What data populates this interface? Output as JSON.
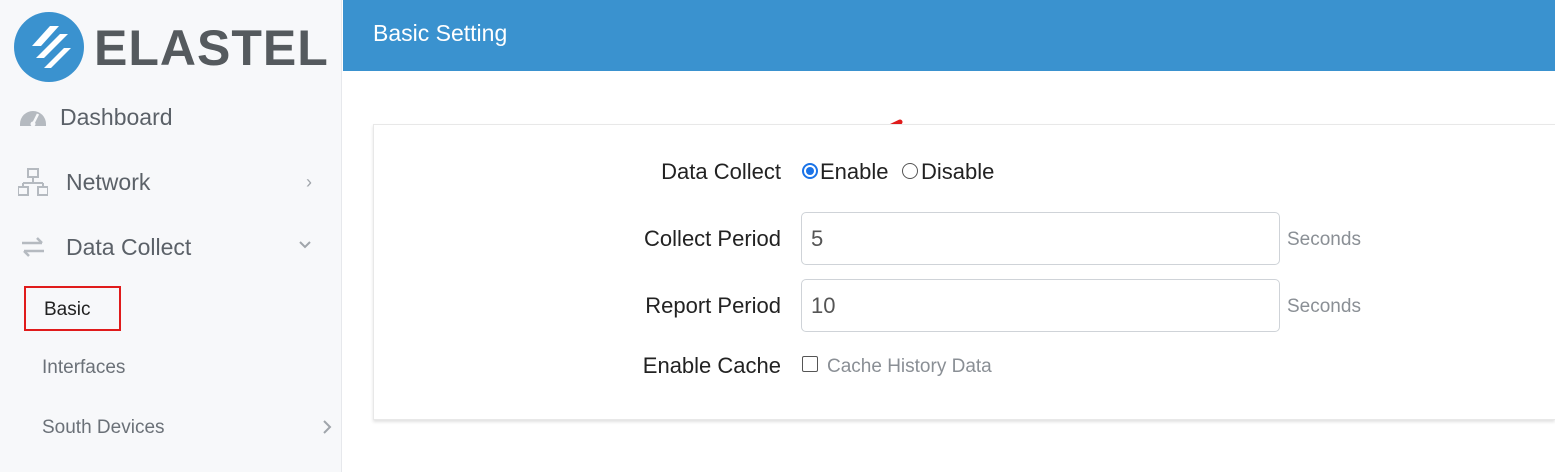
{
  "brand": {
    "name": "ELASTEL",
    "logo_color": "#3a92cf"
  },
  "sidebar": {
    "items": [
      {
        "label": "Dashboard",
        "icon": "dashboard-gauge-icon"
      },
      {
        "label": "Network",
        "icon": "network-icon",
        "chevron": "›"
      },
      {
        "label": "Data Collect",
        "icon": "transfer-arrows-icon",
        "chevron": "⌄"
      }
    ],
    "sub_items": [
      {
        "label": "Basic",
        "selected": true
      },
      {
        "label": "Interfaces"
      },
      {
        "label": "South Devices",
        "chevron": "›"
      }
    ]
  },
  "header": {
    "title": "Basic Setting",
    "color": "#3a92cf"
  },
  "form": {
    "data_collect": {
      "label": "Data Collect",
      "options": [
        {
          "label": "Enable",
          "checked": true
        },
        {
          "label": "Disable",
          "checked": false
        }
      ]
    },
    "collect_period": {
      "label": "Collect Period",
      "value": "5",
      "unit": "Seconds"
    },
    "report_period": {
      "label": "Report Period",
      "value": "10",
      "unit": "Seconds"
    },
    "enable_cache": {
      "label": "Enable Cache",
      "checkbox_label": "Cache History Data",
      "checked": false
    }
  },
  "annotations": {
    "highlight_color": "#e01b1b"
  }
}
